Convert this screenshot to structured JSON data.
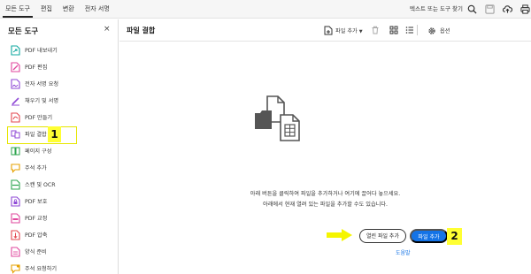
{
  "menu": {
    "items": [
      "모든 도구",
      "편집",
      "변환",
      "전자 서명"
    ],
    "active_index": 0
  },
  "search_link": "텍스트 또는 도구 찾기",
  "top_icons": [
    "search-icon",
    "save-icon",
    "upload-cloud-icon",
    "print-icon"
  ],
  "sidebar": {
    "title": "모든 도구",
    "close": "×",
    "tools": [
      {
        "label": "PDF 내보내기",
        "icon": "export-pdf-icon",
        "color": "#11a8a0"
      },
      {
        "label": "PDF 편집",
        "icon": "edit-pdf-icon",
        "color": "#e0479e"
      },
      {
        "label": "전자 서명 요청",
        "icon": "request-esign-icon",
        "color": "#8f49d6"
      },
      {
        "label": "채우기 및 서명",
        "icon": "fill-sign-icon",
        "color": "#8f49d6"
      },
      {
        "label": "PDF 만들기",
        "icon": "create-pdf-icon",
        "color": "#e34850"
      },
      {
        "label": "파일 결합",
        "icon": "combine-files-icon",
        "color": "#8f49d6"
      },
      {
        "label": "페이지 구성",
        "icon": "organize-pages-icon",
        "color": "#2da44e"
      },
      {
        "label": "주석 추가",
        "icon": "comment-icon",
        "color": "#e6a100"
      },
      {
        "label": "스캔 및 OCR",
        "icon": "scan-ocr-icon",
        "color": "#2da44e"
      },
      {
        "label": "PDF 보호",
        "icon": "protect-pdf-icon",
        "color": "#8f49d6"
      },
      {
        "label": "PDF 교정",
        "icon": "redact-pdf-icon",
        "color": "#e0479e"
      },
      {
        "label": "PDF 압축",
        "icon": "compress-pdf-icon",
        "color": "#e34850"
      },
      {
        "label": "양식 준비",
        "icon": "prepare-form-icon",
        "color": "#e0479e"
      },
      {
        "label": "주석 요청하기",
        "icon": "request-comments-icon",
        "color": "#e6a100"
      }
    ],
    "highlight_index": 5
  },
  "badges": {
    "first": "1",
    "second": "2"
  },
  "main": {
    "title": "파일 결합",
    "toolbar": {
      "add_files": "파일 추가",
      "options": "옵션"
    },
    "message_line1": "아래 버튼을 클릭하여 파일을 추가하거나 여기에 끌어다 놓으세요.",
    "message_line2": "아래에서 현재 열려 있는 파일을 추가할 수도 있습니다.",
    "add_open_files": "열린 파일 추가",
    "add_files_button": "파일 추가",
    "help": "도움말"
  },
  "colors": {
    "accent": "#1473e6",
    "highlight": "#ffff33"
  }
}
